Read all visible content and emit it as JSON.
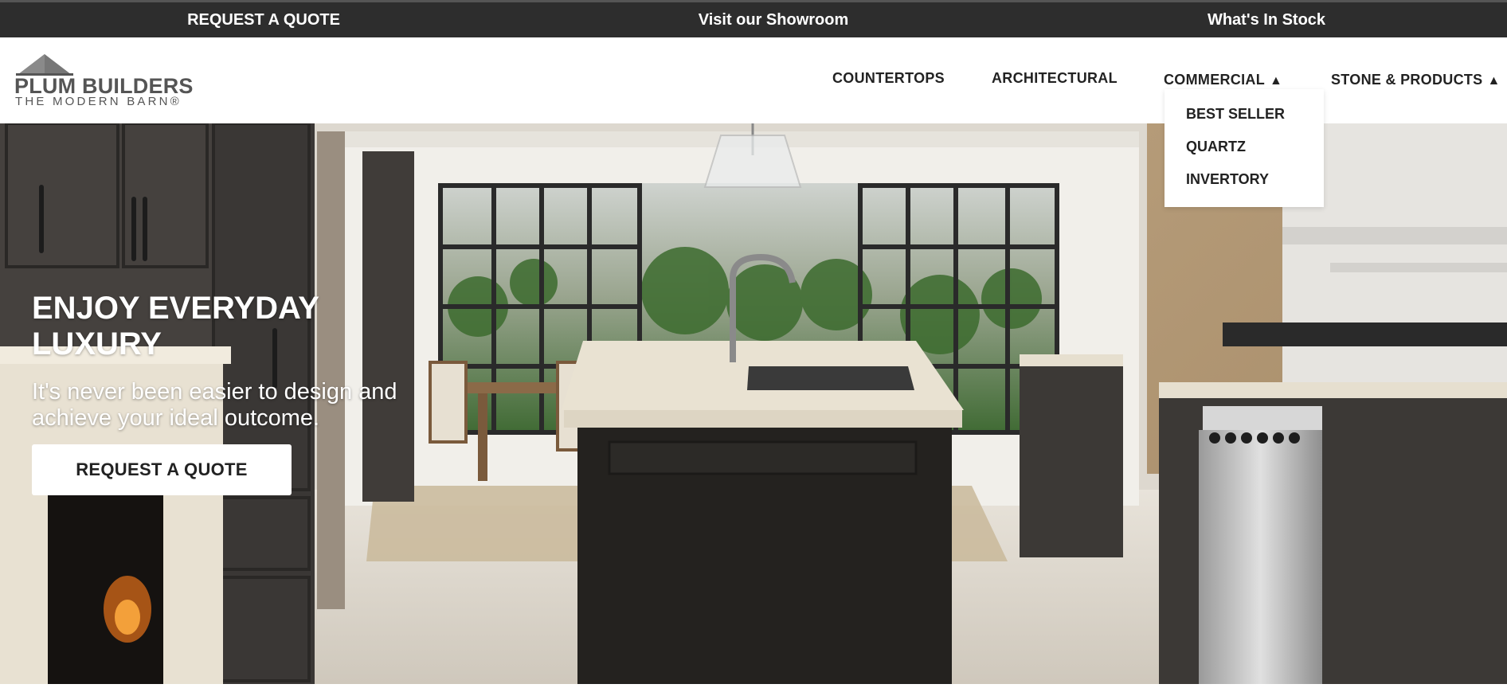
{
  "topbar": {
    "request_quote": "REQUEST A QUOTE",
    "showroom": "Visit our Showroom",
    "in_stock": "What's In Stock"
  },
  "logo": {
    "name": "PLUM BUILDERS",
    "tagline": "THE MODERN BARN®",
    "icon": "barn-roof-icon"
  },
  "nav": {
    "items": [
      {
        "label": "COUNTERTOPS",
        "has_menu": false
      },
      {
        "label": "ARCHITECTURAL",
        "has_menu": false
      },
      {
        "label": "COMMERCIAL",
        "has_menu": true,
        "expanded": true
      },
      {
        "label": "STONE & PRODUCTS",
        "has_menu": true,
        "expanded": false
      }
    ],
    "caret": "▲"
  },
  "dropdown": {
    "items": [
      "BEST SELLER",
      "QUARTZ",
      "INVERTORY"
    ]
  },
  "hero": {
    "title": "ENJOY EVERYDAY LUXURY",
    "subtitle": "It's never been easier to design and achieve your ideal outcome.",
    "cta": "REQUEST A QUOTE",
    "image": "modern-kitchen-photo"
  },
  "colors": {
    "topbar_bg": "#2d2d2d",
    "logo_gray": "#555555",
    "text_dark": "#222222"
  }
}
